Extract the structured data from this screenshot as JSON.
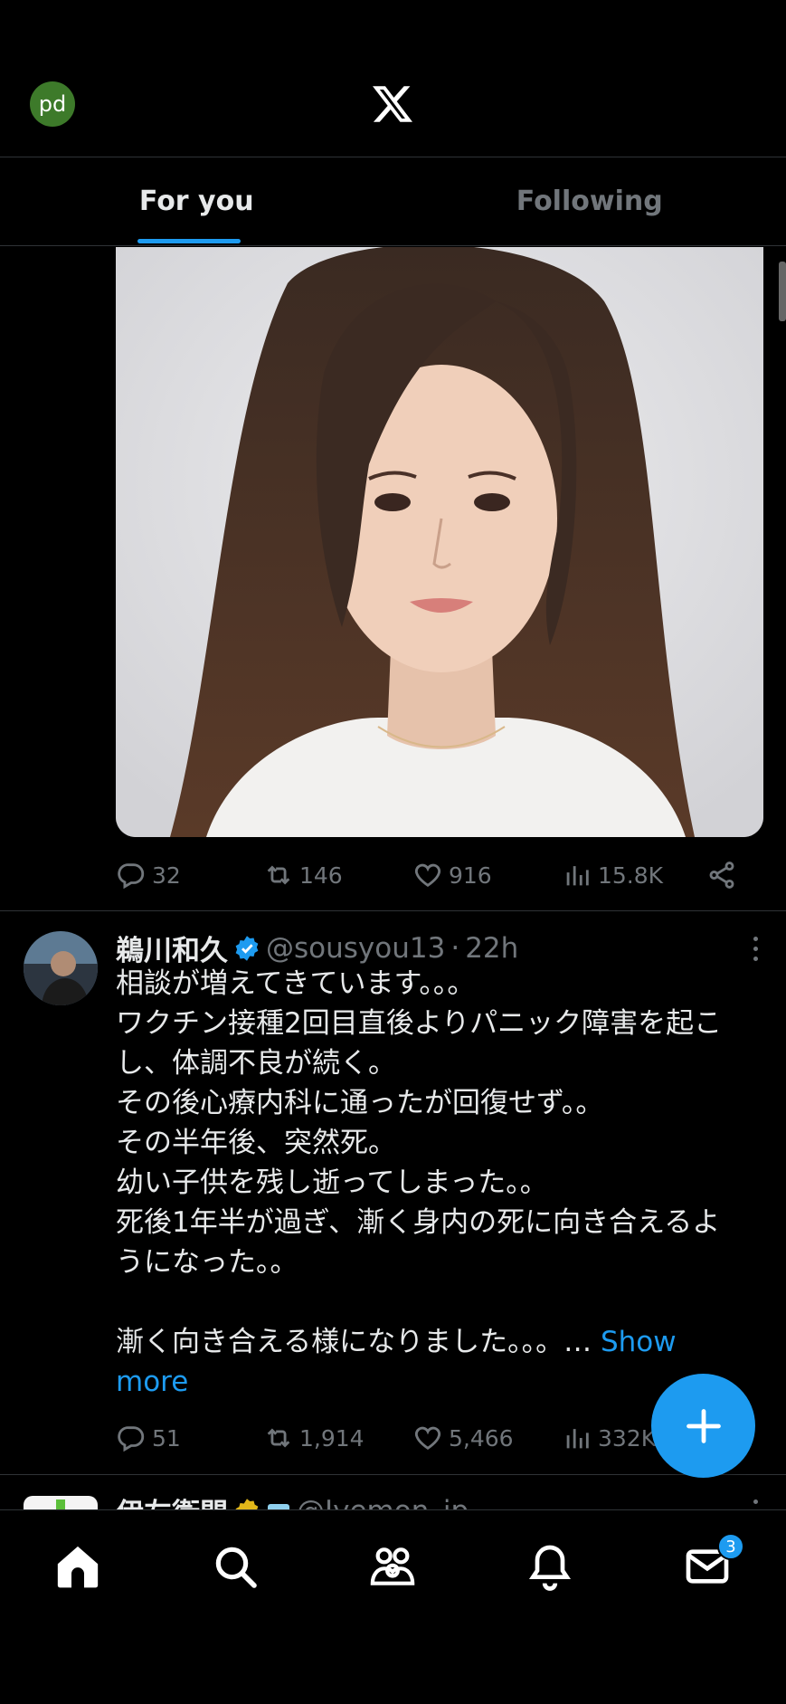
{
  "header": {
    "avatar_initials": "pd",
    "logo_icon": "x-logo-icon"
  },
  "tabs": [
    {
      "label": "For you",
      "active": true
    },
    {
      "label": "Following",
      "active": false
    }
  ],
  "tweet1": {
    "media_icon": "portrait-photo",
    "stats": {
      "replies": "32",
      "retweets": "146",
      "likes": "916",
      "views": "15.8K"
    }
  },
  "tweet2": {
    "display_name": "鵜川和久",
    "handle": "@sousyou13",
    "separator": "·",
    "time": "22h",
    "lines": [
      "相談が増えてきています。。。",
      "ワクチン接種2回目直後よりパニック障害を起こ",
      "し、体調不良が続く。",
      "その後心療内科に通ったが回復せず。。",
      "その半年後、突然死。",
      "幼い子供を残し逝ってしまった。。",
      "死後1年半が過ぎ、漸く身内の死に向き合えるよ",
      "うになった。。",
      "",
      "漸く向き合える様になりました。。。…"
    ],
    "show_more_1": "Show",
    "show_more_2": "more",
    "stats": {
      "replies": "51",
      "retweets": "1,914",
      "likes": "5,466",
      "views": "332K"
    }
  },
  "tweet3": {
    "display_name": "伊左衛門",
    "handle": "@Iyemon_jp"
  },
  "nav": {
    "items": [
      "home-icon",
      "search-icon",
      "communities-icon",
      "notifications-icon",
      "messages-icon"
    ],
    "messages_badge": "3"
  },
  "colors": {
    "accent": "#1d9bf0",
    "background": "#000000",
    "muted": "#71767b",
    "text": "#e7e9ea",
    "divider": "#2f3336"
  }
}
